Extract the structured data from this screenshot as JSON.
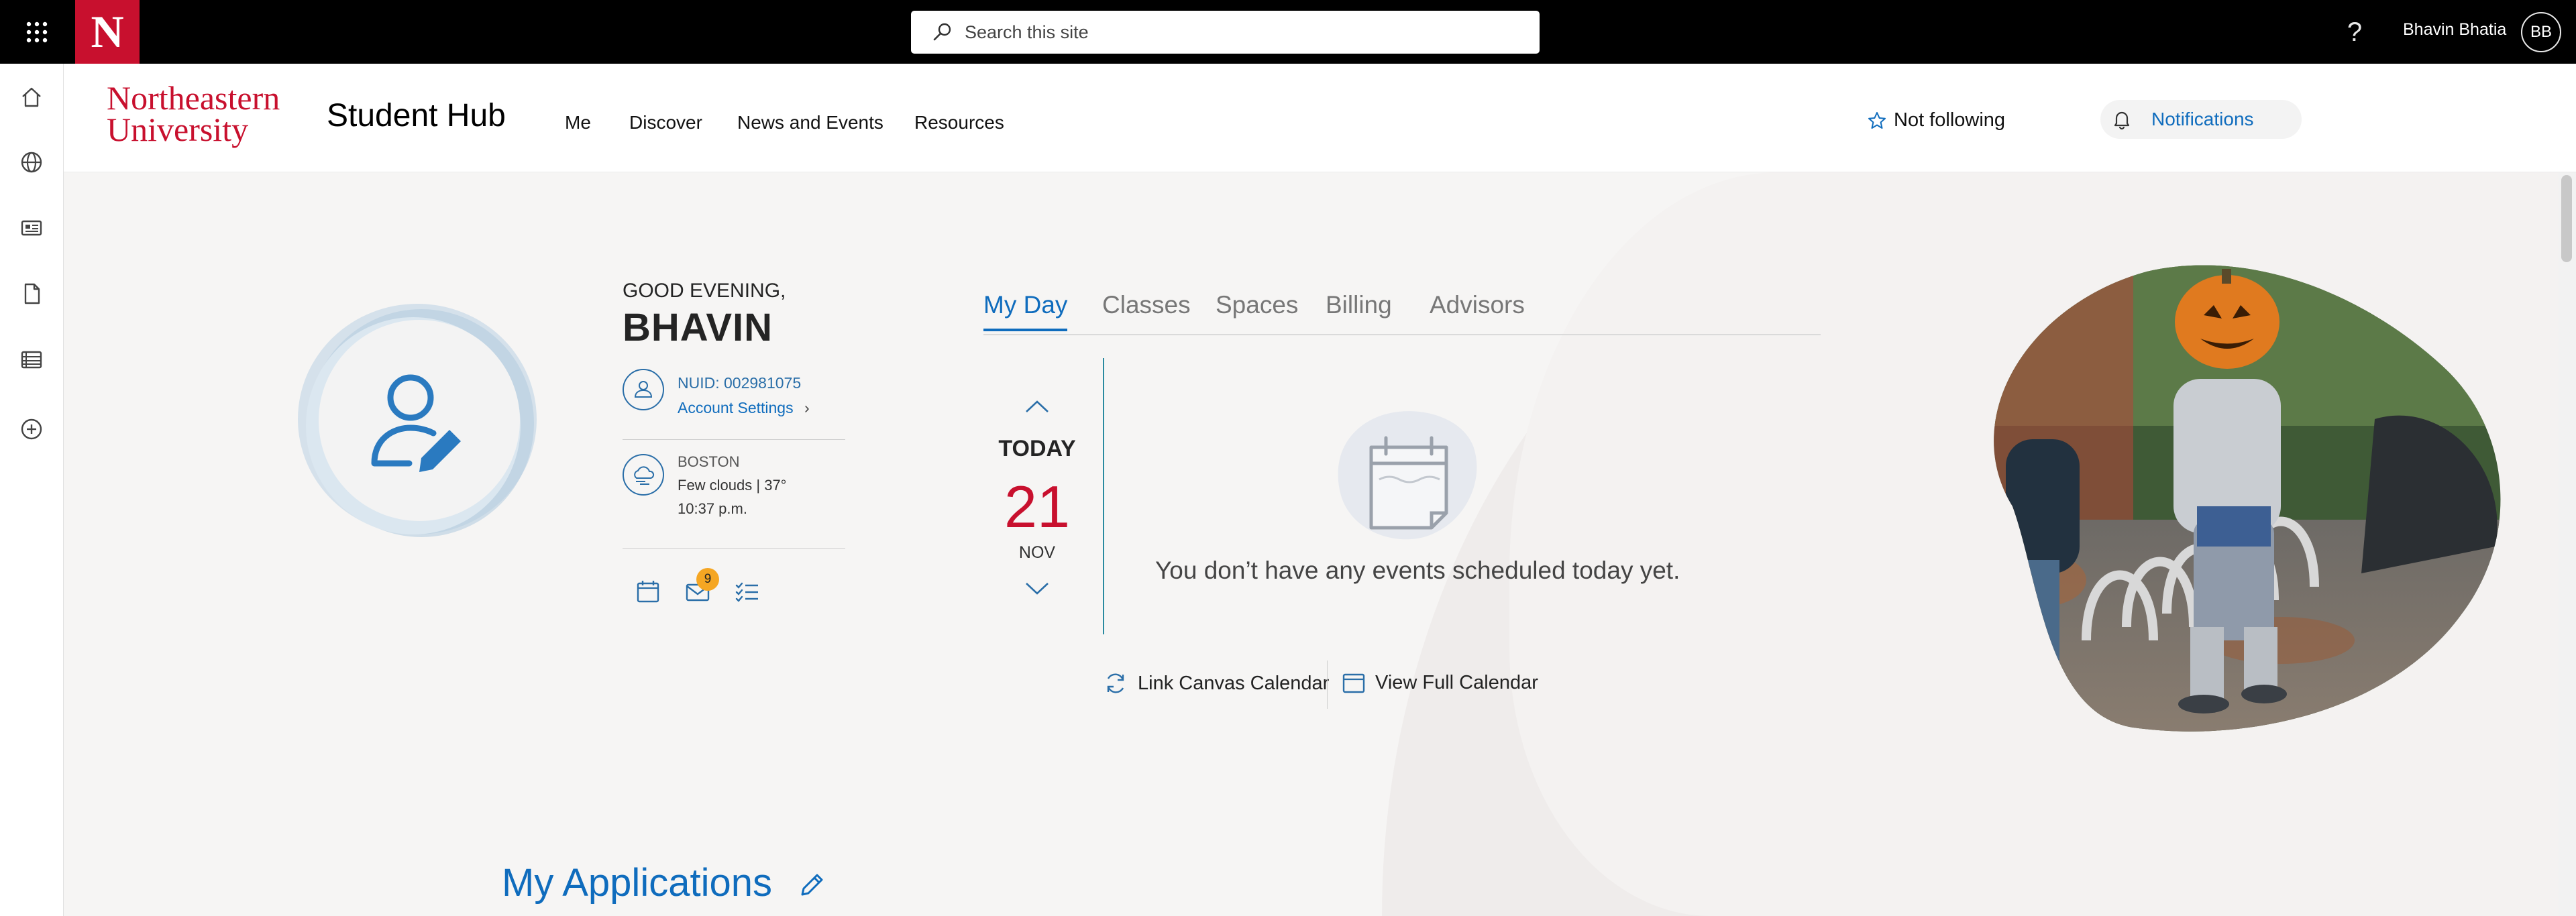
{
  "suite_bar": {
    "logo_letter": "N",
    "search_placeholder": "Search this site",
    "help": "?",
    "user_name": "Bhavin Bhatia",
    "user_initials": "BB"
  },
  "site_header": {
    "university_line1": "Northeastern",
    "university_line2": "University",
    "title": "Student Hub",
    "nav": [
      "Me",
      "Discover",
      "News and Events",
      "Resources"
    ],
    "follow_label": "Not following",
    "notifications_label": "Notifications"
  },
  "profile": {
    "greeting": "GOOD EVENING,",
    "first_name": "BHAVIN",
    "nuid": "NUID: 002981075",
    "account_settings": "Account Settings",
    "city": "BOSTON",
    "weather": "Few clouds | 37°",
    "time": "10:37 p.m.",
    "mail_badge": "9"
  },
  "tabs": [
    "My Day",
    "Classes",
    "Spaces",
    "Billing",
    "Advisors"
  ],
  "my_day": {
    "today": "TODAY",
    "day_number": "21",
    "month": "NOV",
    "empty_message": "You don’t have any events scheduled today yet.",
    "link_canvas": "Link Canvas Calendar",
    "view_full": "View Full Calendar"
  },
  "applications": {
    "title": "My Applications"
  },
  "colors": {
    "brand_red": "#c8102e",
    "link_blue": "#0f6cbd",
    "badge_orange": "#f5a623"
  }
}
